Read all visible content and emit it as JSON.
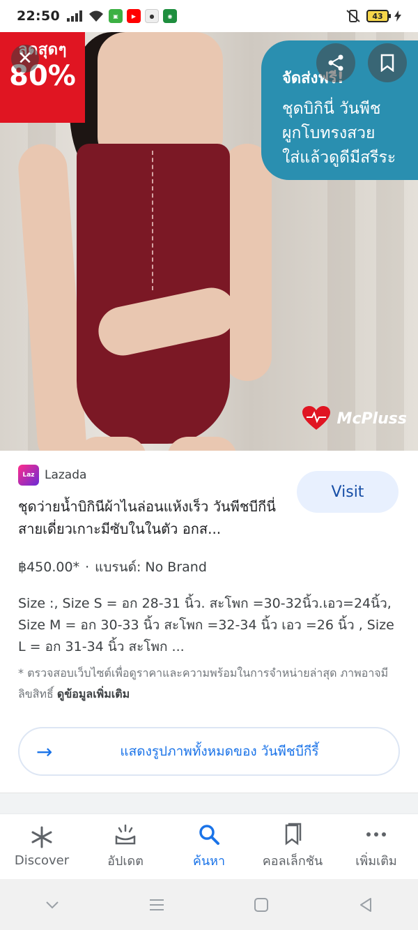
{
  "status_bar": {
    "time": "22:50",
    "battery": "43"
  },
  "hero": {
    "promo_small": "ลดสุดๆ",
    "promo_big": "80%",
    "badge_title": "จัดส่งฟรี!",
    "badge_lines": [
      "ชุดบิกินี่ วันพีช",
      "ผูกโบทรงสวย",
      "ใส่แล้วดูดีมีสรีระ"
    ],
    "brand_name": "McPluss"
  },
  "result": {
    "source_logo_text": "Laz",
    "source_name": "Lazada",
    "visit_label": "Visit",
    "title": "ชุดว่ายน้ำบิกินีผ้าไนล่อนแห้งเร็ว วันพีชบีกีนี่สายเดี่ยวเกาะมีซับในในตัว อกส...",
    "price": "฿450.00*",
    "brand": "แบรนด์: No Brand",
    "description": "Size :, Size S = อก 28-31 นิ้ว. สะโพก =30-32นิ้ว.เอว=24นิ้ว, Size M = อก 30-33 นิ้ว สะโพก =32-34 นิ้ว เอว =26 นิ้ว , Size L = อก 31-34 นิ้ว สะโพก ...",
    "note": "* ตรวจสอบเว็บไซต์เพื่อดูราคาและความพร้อมในการจำหน่ายล่าสุด ภาพอาจมีลิขสิทธิ์",
    "note_more": "ดูข้อมูลเพิ่มเติม",
    "all_images_label": "แสดงรูปภาพทั้งหมดของ วันพีชบีกีรี้"
  },
  "bottom_nav": {
    "items": [
      {
        "label": "Discover",
        "icon": "asterisk-icon"
      },
      {
        "label": "อัปเดต",
        "icon": "updates-icon"
      },
      {
        "label": "ค้นหา",
        "icon": "search-icon"
      },
      {
        "label": "คอลเล็กชัน",
        "icon": "collections-icon"
      },
      {
        "label": "เพิ่มเติม",
        "icon": "more-icon"
      }
    ],
    "active_index": 2
  },
  "colors": {
    "accent": "#1a73e8",
    "promo_red": "#e01522",
    "badge_blue": "#2a8fb0",
    "suit": "#7b1825"
  }
}
